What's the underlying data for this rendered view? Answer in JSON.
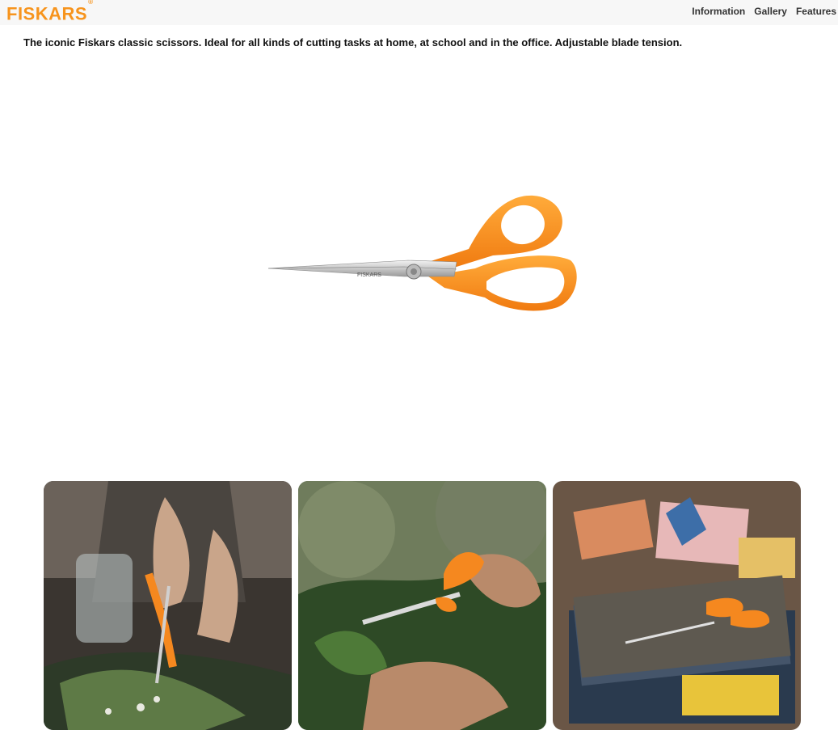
{
  "header": {
    "brand": "FISKARS",
    "nav": [
      "Information",
      "Gallery",
      "Features"
    ]
  },
  "product": {
    "description": "The iconic Fiskars classic scissors. Ideal for all kinds of cutting tasks at home, at school and in the office. Adjustable blade tension.",
    "blade_imprint": "FISKARS"
  },
  "colors": {
    "brand": "#f7941d",
    "handle": "#f5881f"
  },
  "gallery": [
    {
      "scene": "florist cutting flower stems"
    },
    {
      "scene": "cutting herbs in garden"
    },
    {
      "scene": "scissors on books at craft desk"
    }
  ]
}
